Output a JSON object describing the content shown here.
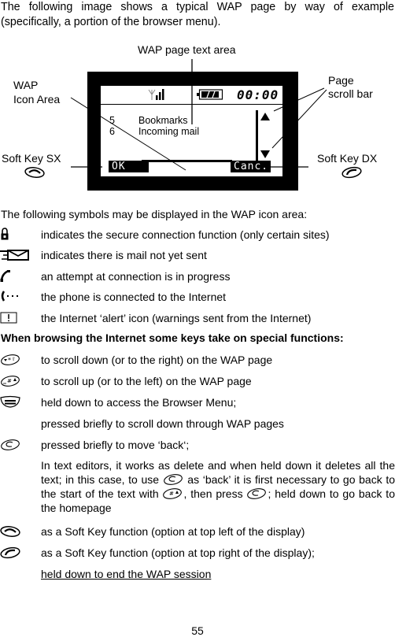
{
  "intro": {
    "line1": "The following image shows a typical WAP page by way of example",
    "line2": "(specifically, a portion of the browser menu)."
  },
  "diagram": {
    "labels": {
      "text_area": "WAP page text area",
      "icon_area_line1": "WAP",
      "icon_area_line2": "Icon Area",
      "scroll_line1": "Page",
      "scroll_line2": "scroll bar",
      "soft_key_sx": "Soft Key SX",
      "soft_key_dx": "Soft Key DX"
    },
    "screen": {
      "clock": "00:00",
      "menu_items": [
        {
          "number": "5",
          "label": "Bookmarks"
        },
        {
          "number": "6",
          "label": "Incoming mail"
        }
      ],
      "left_softkey": "OK",
      "right_softkey": "Canc."
    }
  },
  "symbols": {
    "heading": "The following symbols may be displayed in the WAP icon area:",
    "items": [
      {
        "icon": "lock-icon",
        "text": "indicates the secure connection function (only certain sites)"
      },
      {
        "icon": "unsent-mail-icon",
        "text": "indicates there is mail not yet sent"
      },
      {
        "icon": "handset-icon",
        "text": "an attempt at connection is in progress"
      },
      {
        "icon": "connected-icon",
        "text": "the phone is connected to the Internet"
      },
      {
        "icon": "alert-icon",
        "text": "the Internet ‘alert’ icon (warnings sent from the Internet)"
      }
    ]
  },
  "keys": {
    "heading": "When browsing the Internet some keys take on special functions:",
    "items": [
      {
        "icon": "star-key-icon",
        "text": "to scroll down (or to the right) on the WAP page"
      },
      {
        "icon": "hash-key-icon",
        "text": "to scroll up (or to the left) on the WAP page"
      },
      {
        "icon": "menu-key-icon",
        "text": "held down to access the Browser Menu;",
        "text2": "pressed briefly to scroll down through WAP pages"
      },
      {
        "icon": "c-key-icon",
        "text": "pressed briefly to move ‘back‘;"
      }
    ],
    "c_key_para": {
      "part1": "In text editors, it works as delete and when held down it deletes all the text; in this case, to use ",
      "part2": " as ‘back’ it is first necessary to go back to the start of the text with ",
      "part3": ", then press ",
      "part4": "; held down to go back to the homepage"
    },
    "soft_keys": [
      {
        "icon": "soft-key-left-icon",
        "text": "as a Soft Key function (option at top left of the display)"
      },
      {
        "icon": "soft-key-right-icon",
        "text": "as a Soft Key function (option at top right of the display);",
        "text2": "held down to end the WAP session"
      }
    ]
  },
  "page_number": "55"
}
